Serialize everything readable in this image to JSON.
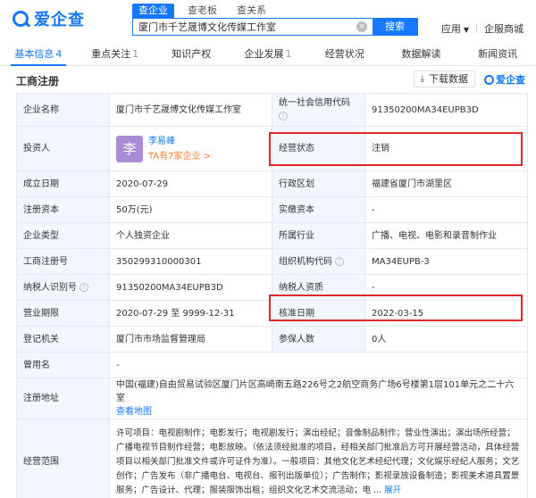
{
  "header": {
    "logo_text": "爱企查",
    "search_tabs": [
      "查企业",
      "查老板",
      "查关系"
    ],
    "search_value": "厦门市千艺晟博文化传媒工作室",
    "search_button": "搜索",
    "links": [
      "应用",
      "企服商城"
    ]
  },
  "nav": [
    {
      "label": "基本信息",
      "count": "4"
    },
    {
      "label": "重点关注",
      "count": "1"
    },
    {
      "label": "知识产权",
      "count": ""
    },
    {
      "label": "企业发展",
      "count": "1"
    },
    {
      "label": "经营状况",
      "count": ""
    },
    {
      "label": "数据解读",
      "count": ""
    },
    {
      "label": "新闻资讯",
      "count": ""
    }
  ],
  "section": {
    "title": "工商注册",
    "download_label": "下载数据",
    "brand_label": "爱企查"
  },
  "table": {
    "company_name_label": "企业名称",
    "company_name": "厦门市千艺晟博文化传媒工作室",
    "credit_code_label": "统一社会信用代码",
    "credit_code": "91350200MA34EUPB3D",
    "investor_label": "投资人",
    "investor_avatar": "李",
    "investor_name": "李易峰",
    "investor_sub": "TA有7家企业 >",
    "status_label": "经营状态",
    "status": "注销",
    "founded_label": "成立日期",
    "founded": "2020-07-29",
    "region_label": "行政区划",
    "region": "福建省厦门市湖里区",
    "capital_label": "注册资本",
    "capital": "50万(元)",
    "paid_capital_label": "实缴资本",
    "paid_capital": "-",
    "type_label": "企业类型",
    "type": "个人独资企业",
    "industry_label": "所属行业",
    "industry": "广播、电视、电影和录音制作业",
    "reg_no_label": "工商注册号",
    "reg_no": "350299310000301",
    "org_code_label": "组织机构代码",
    "org_code": "MA34EUPB-3",
    "taxpayer_id_label": "纳税人识别号",
    "taxpayer_id": "91350200MA34EUPB3D",
    "taxpayer_qual_label": "纳税人资质",
    "taxpayer_qual": "-",
    "term_label": "营业期限",
    "term": "2020-07-29 至 9999-12-31",
    "approval_date_label": "核准日期",
    "approval_date": "2022-03-15",
    "authority_label": "登记机关",
    "authority": "厦门市市场监督管理局",
    "insured_label": "参保人数",
    "insured": "0人",
    "former_name_label": "曾用名",
    "former_name": "-",
    "address_label": "注册地址",
    "address": "中国(福建)自由贸易试验区厦门片区高崎南五路226号之2航空商务广场6号楼第1层101单元之二十六室",
    "map_link": "查看地图",
    "scope_label": "经营范围",
    "scope": "许可项目：电视剧制作；电影发行；电视剧发行；演出经纪；音像制品制作；营业性演出；演出场所经营；广播电视节目制作经营；电影放映。（依法须经批准的项目，经相关部门批准后方可开展经营活动，具体经营项目以相关部门批准文件或许可证件为准）。一般项目：其他文化艺术经纪代理；文化娱乐经纪人服务；文艺创作；广告发布（非广播电台、电视台、报刊出版单位）；广告制作；影视录放设备制造；影视美术道具置景服务；广告设计、代理；服装服饰出租；组织文化艺术交流活动；电 ...",
    "expand": "展开"
  }
}
